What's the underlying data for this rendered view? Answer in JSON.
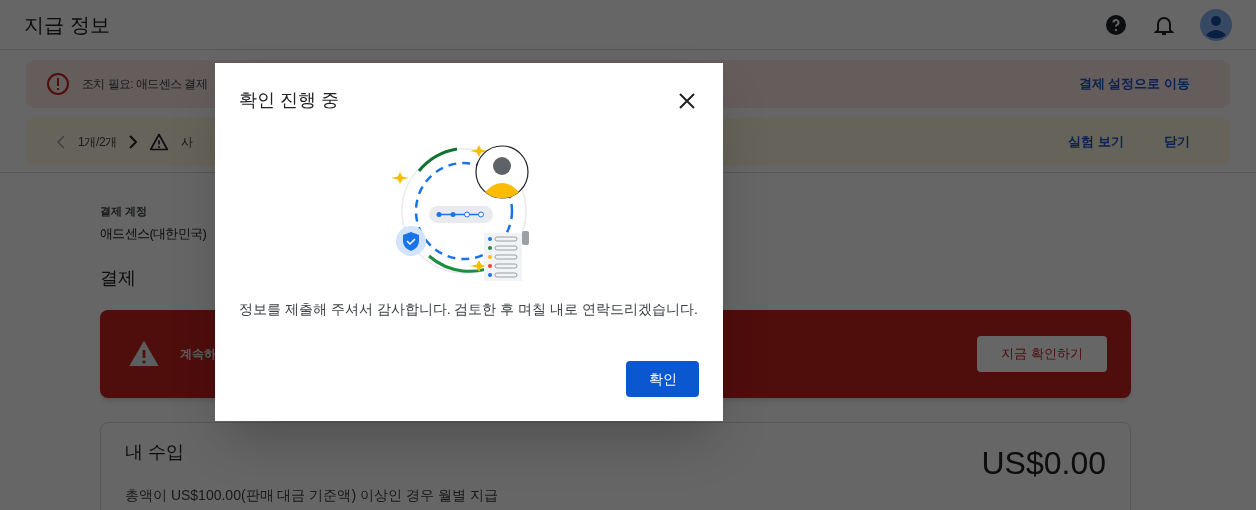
{
  "header": {
    "title": "지급 정보"
  },
  "banners": [
    {
      "kind": "error",
      "message": "조치 필요: 애드센스 결제",
      "actions": [
        "결제 설정으로 이동"
      ]
    },
    {
      "kind": "warning",
      "pager": "1개/2개",
      "message": "사",
      "actions": [
        "실험 보기",
        "닫기"
      ]
    }
  ],
  "account": {
    "label": "결제 계정",
    "value": "애드센스(대한민국)"
  },
  "payments": {
    "heading": "결제",
    "alert": {
      "message": "계속하",
      "button": "지금 확인하기"
    },
    "earnings": {
      "title": "내 수입",
      "amount": "US$0.00",
      "note": "총액이 US$100.00(판매 대금 기준액) 이상인 경우 월별 지급"
    }
  },
  "dialog": {
    "title": "확인 진행 중",
    "message": "정보를 제출해 주셔서 감사합니다. 검토한 후 며칠 내로 연락드리겠습니다.",
    "button": "확인"
  }
}
